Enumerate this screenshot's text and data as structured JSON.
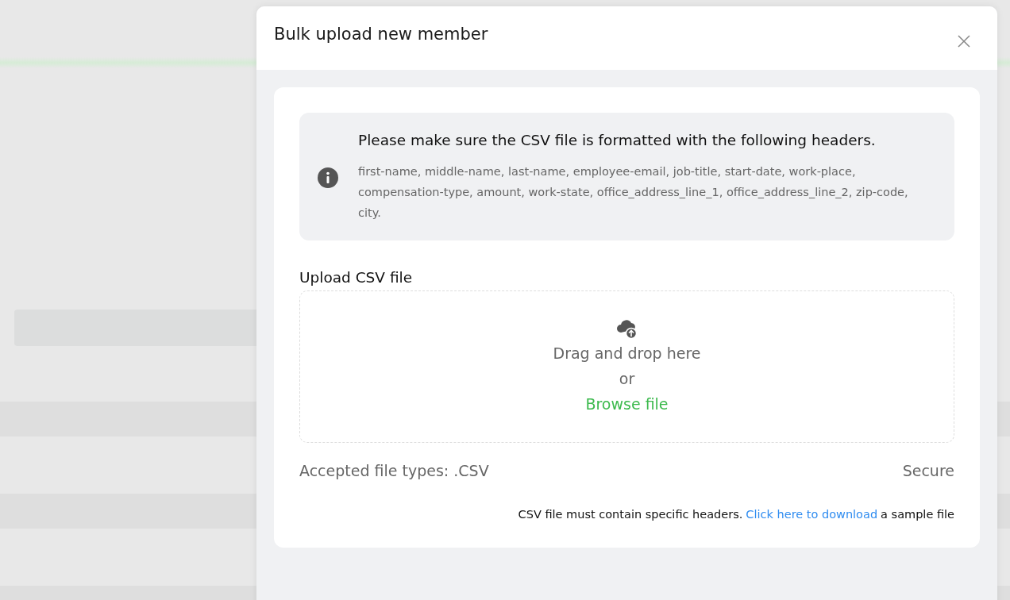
{
  "dialog": {
    "title": "Bulk upload new member",
    "notice": {
      "heading": "Please make sure the CSV file is formatted with the following headers.",
      "headers": "first-name, middle-name, last-name, employee-email, job-title, start-date, work-place, compensation-type, amount, work-state, office_address_line_1, office_address_line_2, zip-code, city."
    },
    "upload": {
      "label": "Upload CSV file",
      "drop_text": "Drag and drop here",
      "or_text": "or",
      "browse": "Browse file"
    },
    "accepted": "Accepted file types: .CSV",
    "secure": "Secure",
    "footnote": {
      "before": "CSV file must contain specific headers.",
      "link": "Click here to download",
      "after": "a sample file"
    }
  }
}
